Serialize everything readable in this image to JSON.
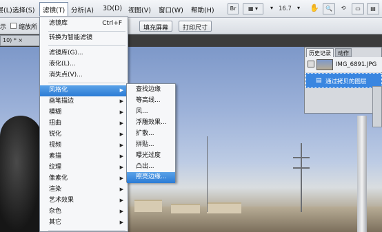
{
  "menubar": {
    "items": [
      "图层(L)",
      "选择(S)",
      "滤镜(T)",
      "分析(A)",
      "3D(D)",
      "视图(V)",
      "窗口(W)",
      "帮助(H)"
    ],
    "icon_br": "Br",
    "zoom": "16.7"
  },
  "optbar": {
    "prefix": "示",
    "checkbox_label": "缩放所",
    "buttons": [
      "填充屏幕",
      "打印尺寸"
    ]
  },
  "document": {
    "tab": "10) * ×"
  },
  "filter_menu": {
    "items": [
      {
        "label": "滤镜库",
        "shortcut": "Ctrl+F"
      },
      {
        "label": "转换为智能滤镜"
      },
      {
        "label": "滤镜库(G)..."
      },
      {
        "label": "液化(L)..."
      },
      {
        "label": "消失点(V)..."
      },
      {
        "label": "风格化"
      },
      {
        "label": "画笔描边"
      },
      {
        "label": "模糊"
      },
      {
        "label": "扭曲"
      },
      {
        "label": "锐化"
      },
      {
        "label": "视频"
      },
      {
        "label": "素描"
      },
      {
        "label": "纹理"
      },
      {
        "label": "像素化"
      },
      {
        "label": "渲染"
      },
      {
        "label": "艺术效果"
      },
      {
        "label": "杂色"
      },
      {
        "label": "其它"
      }
    ]
  },
  "stylize_menu": {
    "items": [
      "查找边缘",
      "等高线...",
      "风...",
      "浮雕效果...",
      "扩散...",
      "拼贴...",
      "曝光过度",
      "凸出...",
      "照亮边缘..."
    ]
  },
  "history_panel": {
    "tabs": [
      "历史记录",
      "动作"
    ],
    "snapshot": "IMG_6891.JPG",
    "state": "通过拷贝的图层"
  },
  "colors": {
    "menu_highlight": "#2a7bd5",
    "sky": "#9db2d9"
  }
}
